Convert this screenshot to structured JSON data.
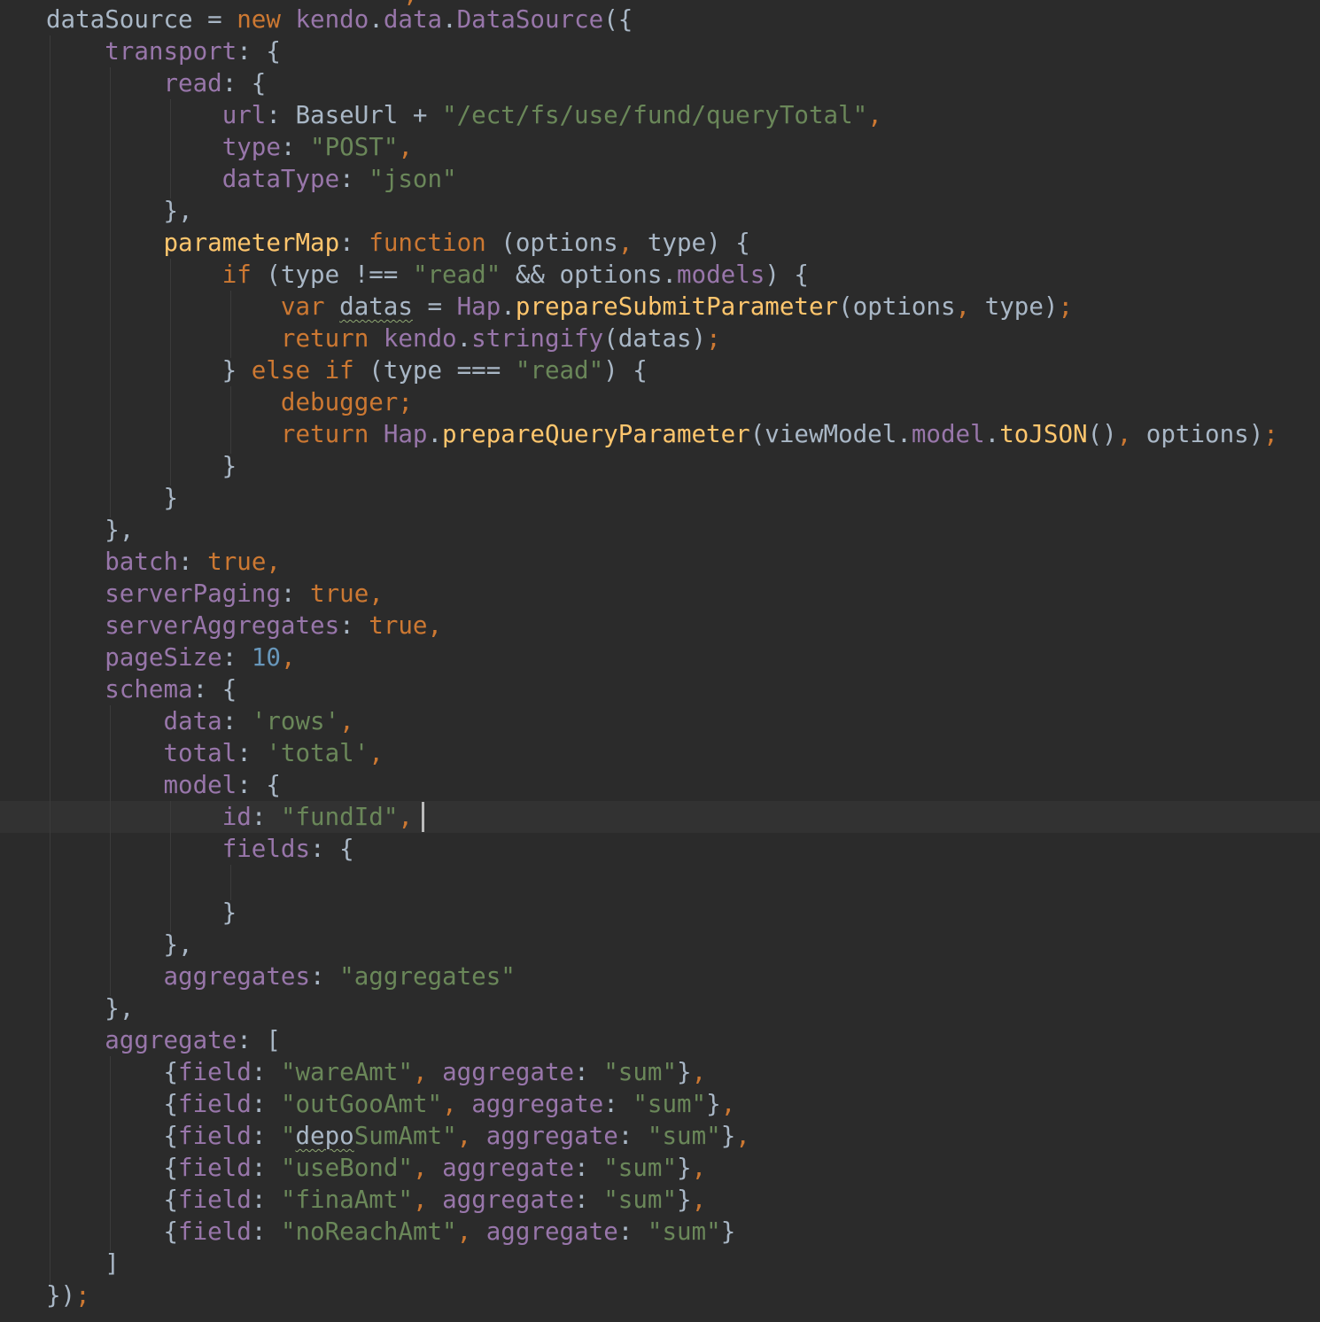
{
  "editor": {
    "colors": {
      "background": "#2b2b2b",
      "current_line": "#323232",
      "default_text": "#a9b7c6",
      "keyword": "#cc7832",
      "property": "#9876aa",
      "string": "#6a8759",
      "number": "#6897bb",
      "function": "#ffc66d",
      "indent_guide": "#3b3b3b",
      "caret": "#bbbbbb"
    },
    "cut_top_text": ",",
    "current_line_number": 26,
    "lines": [
      [
        [
          "t",
          "dataSource = "
        ],
        [
          "k",
          "new "
        ],
        [
          "p",
          "kendo"
        ],
        [
          "t",
          "."
        ],
        [
          "p",
          "data"
        ],
        [
          "t",
          "."
        ],
        [
          "p",
          "DataSource"
        ],
        [
          "t",
          "({"
        ]
      ],
      [
        [
          "t",
          "    "
        ],
        [
          "p",
          "transport"
        ],
        [
          "t",
          ": {"
        ]
      ],
      [
        [
          "t",
          "        "
        ],
        [
          "p",
          "read"
        ],
        [
          "t",
          ": {"
        ]
      ],
      [
        [
          "t",
          "            "
        ],
        [
          "p",
          "url"
        ],
        [
          "t",
          ": BaseUrl + "
        ],
        [
          "s",
          "\"/ect/fs/use/fund/queryTotal\""
        ],
        [
          "k",
          ","
        ]
      ],
      [
        [
          "t",
          "            "
        ],
        [
          "p",
          "type"
        ],
        [
          "t",
          ": "
        ],
        [
          "s",
          "\"POST\""
        ],
        [
          "k",
          ","
        ]
      ],
      [
        [
          "t",
          "            "
        ],
        [
          "p",
          "dataType"
        ],
        [
          "t",
          ": "
        ],
        [
          "s",
          "\"json\""
        ]
      ],
      [
        [
          "t",
          "        },"
        ]
      ],
      [
        [
          "t",
          "        "
        ],
        [
          "f",
          "parameterMap"
        ],
        [
          "t",
          ": "
        ],
        [
          "k",
          "function "
        ],
        [
          "t",
          "(options"
        ],
        [
          "k",
          ","
        ],
        [
          "t",
          " type) {"
        ]
      ],
      [
        [
          "t",
          "            "
        ],
        [
          "k",
          "if "
        ],
        [
          "t",
          "(type !== "
        ],
        [
          "s",
          "\"read\""
        ],
        [
          "t",
          " && options."
        ],
        [
          "p",
          "models"
        ],
        [
          "t",
          ") {"
        ]
      ],
      [
        [
          "t",
          "                "
        ],
        [
          "k",
          "var "
        ],
        [
          "w",
          "datas"
        ],
        [
          "t",
          " = "
        ],
        [
          "p",
          "Hap"
        ],
        [
          "t",
          "."
        ],
        [
          "f",
          "prepareSubmitParameter"
        ],
        [
          "t",
          "(options"
        ],
        [
          "k",
          ","
        ],
        [
          "t",
          " type)"
        ],
        [
          "k",
          ";"
        ]
      ],
      [
        [
          "t",
          "                "
        ],
        [
          "k",
          "return "
        ],
        [
          "p",
          "kendo"
        ],
        [
          "t",
          "."
        ],
        [
          "p",
          "stringify"
        ],
        [
          "t",
          "(datas)"
        ],
        [
          "k",
          ";"
        ]
      ],
      [
        [
          "t",
          "            } "
        ],
        [
          "k",
          "else if "
        ],
        [
          "t",
          "(type === "
        ],
        [
          "s",
          "\"read\""
        ],
        [
          "t",
          ") {"
        ]
      ],
      [
        [
          "t",
          "                "
        ],
        [
          "k",
          "debugger;"
        ]
      ],
      [
        [
          "t",
          "                "
        ],
        [
          "k",
          "return "
        ],
        [
          "p",
          "Hap"
        ],
        [
          "t",
          "."
        ],
        [
          "f",
          "prepareQueryParameter"
        ],
        [
          "t",
          "(viewModel."
        ],
        [
          "p",
          "model"
        ],
        [
          "t",
          "."
        ],
        [
          "f",
          "toJSON"
        ],
        [
          "t",
          "()"
        ],
        [
          "k",
          ","
        ],
        [
          "t",
          " options)"
        ],
        [
          "k",
          ";"
        ]
      ],
      [
        [
          "t",
          "            }"
        ]
      ],
      [
        [
          "t",
          "        }"
        ]
      ],
      [
        [
          "t",
          "    },"
        ]
      ],
      [
        [
          "t",
          "    "
        ],
        [
          "p",
          "batch"
        ],
        [
          "t",
          ": "
        ],
        [
          "k",
          "true,"
        ]
      ],
      [
        [
          "t",
          "    "
        ],
        [
          "p",
          "serverPaging"
        ],
        [
          "t",
          ": "
        ],
        [
          "k",
          "true,"
        ]
      ],
      [
        [
          "t",
          "    "
        ],
        [
          "p",
          "serverAggregates"
        ],
        [
          "t",
          ": "
        ],
        [
          "k",
          "true,"
        ]
      ],
      [
        [
          "t",
          "    "
        ],
        [
          "p",
          "pageSize"
        ],
        [
          "t",
          ": "
        ],
        [
          "n",
          "10"
        ],
        [
          "k",
          ","
        ]
      ],
      [
        [
          "t",
          "    "
        ],
        [
          "p",
          "schema"
        ],
        [
          "t",
          ": {"
        ]
      ],
      [
        [
          "t",
          "        "
        ],
        [
          "p",
          "data"
        ],
        [
          "t",
          ": "
        ],
        [
          "s",
          "'rows'"
        ],
        [
          "k",
          ","
        ]
      ],
      [
        [
          "t",
          "        "
        ],
        [
          "p",
          "total"
        ],
        [
          "t",
          ": "
        ],
        [
          "s",
          "'total'"
        ],
        [
          "k",
          ","
        ]
      ],
      [
        [
          "t",
          "        "
        ],
        [
          "p",
          "model"
        ],
        [
          "t",
          ": {"
        ]
      ],
      [
        [
          "t",
          "            "
        ],
        [
          "p",
          "id"
        ],
        [
          "t",
          ": "
        ],
        [
          "s",
          "\"fundId\""
        ],
        [
          "k",
          ","
        ]
      ],
      [
        [
          "t",
          "            "
        ],
        [
          "p",
          "fields"
        ],
        [
          "t",
          ": {"
        ]
      ],
      [],
      [
        [
          "t",
          "            }"
        ]
      ],
      [
        [
          "t",
          "        },"
        ]
      ],
      [
        [
          "t",
          "        "
        ],
        [
          "p",
          "aggregates"
        ],
        [
          "t",
          ": "
        ],
        [
          "s",
          "\"aggregates\""
        ]
      ],
      [
        [
          "t",
          "    },"
        ]
      ],
      [
        [
          "t",
          "    "
        ],
        [
          "p",
          "aggregate"
        ],
        [
          "t",
          ": ["
        ]
      ],
      [
        [
          "t",
          "        {"
        ],
        [
          "p",
          "field"
        ],
        [
          "t",
          ": "
        ],
        [
          "s",
          "\"wareAmt\""
        ],
        [
          "k",
          ","
        ],
        [
          "t",
          " "
        ],
        [
          "p",
          "aggregate"
        ],
        [
          "t",
          ": "
        ],
        [
          "s",
          "\"sum\""
        ],
        [
          "t",
          "}"
        ],
        [
          "k",
          ","
        ]
      ],
      [
        [
          "t",
          "        {"
        ],
        [
          "p",
          "field"
        ],
        [
          "t",
          ": "
        ],
        [
          "s",
          "\"outGooAmt\""
        ],
        [
          "k",
          ","
        ],
        [
          "t",
          " "
        ],
        [
          "p",
          "aggregate"
        ],
        [
          "t",
          ": "
        ],
        [
          "s",
          "\"sum\""
        ],
        [
          "t",
          "}"
        ],
        [
          "k",
          ","
        ]
      ],
      [
        [
          "t",
          "        {"
        ],
        [
          "p",
          "field"
        ],
        [
          "t",
          ": "
        ],
        [
          "s",
          "\""
        ],
        [
          "w",
          "depo"
        ],
        [
          "s",
          "SumAmt\""
        ],
        [
          "k",
          ","
        ],
        [
          "t",
          " "
        ],
        [
          "p",
          "aggregate"
        ],
        [
          "t",
          ": "
        ],
        [
          "s",
          "\"sum\""
        ],
        [
          "t",
          "}"
        ],
        [
          "k",
          ","
        ]
      ],
      [
        [
          "t",
          "        {"
        ],
        [
          "p",
          "field"
        ],
        [
          "t",
          ": "
        ],
        [
          "s",
          "\"useBond\""
        ],
        [
          "k",
          ","
        ],
        [
          "t",
          " "
        ],
        [
          "p",
          "aggregate"
        ],
        [
          "t",
          ": "
        ],
        [
          "s",
          "\"sum\""
        ],
        [
          "t",
          "}"
        ],
        [
          "k",
          ","
        ]
      ],
      [
        [
          "t",
          "        {"
        ],
        [
          "p",
          "field"
        ],
        [
          "t",
          ": "
        ],
        [
          "s",
          "\"finaAmt\""
        ],
        [
          "k",
          ","
        ],
        [
          "t",
          " "
        ],
        [
          "p",
          "aggregate"
        ],
        [
          "t",
          ": "
        ],
        [
          "s",
          "\"sum\""
        ],
        [
          "t",
          "}"
        ],
        [
          "k",
          ","
        ]
      ],
      [
        [
          "t",
          "        {"
        ],
        [
          "p",
          "field"
        ],
        [
          "t",
          ": "
        ],
        [
          "s",
          "\"noReachAmt\""
        ],
        [
          "k",
          ","
        ],
        [
          "t",
          " "
        ],
        [
          "p",
          "aggregate"
        ],
        [
          "t",
          ": "
        ],
        [
          "s",
          "\"sum\""
        ],
        [
          "t",
          "}"
        ]
      ],
      [
        [
          "t",
          "    ]"
        ]
      ],
      [
        [
          "t",
          "})"
        ],
        [
          "k",
          ";"
        ]
      ]
    ]
  }
}
